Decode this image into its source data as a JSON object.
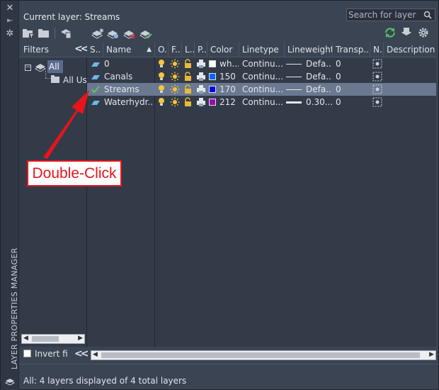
{
  "panel": {
    "vertical_title": "LAYER PROPERTIES MANAGER",
    "current_layer": "Current layer: Streams",
    "search_placeholder": "Search for layer"
  },
  "toolbar": {
    "icons": [
      "new-property-filter-icon",
      "new-group-filter-icon",
      "layer-states-manager-icon",
      "new-layer-icon",
      "new-layer-vp-frozen-icon",
      "delete-layer-icon",
      "set-current-icon",
      "refresh-icon",
      "settings-icon"
    ]
  },
  "filters": {
    "heading": "Filters",
    "tree_all": "All",
    "tree_all_used": "All Us",
    "invert_label": "Invert fi"
  },
  "grid": {
    "columns": [
      "S..",
      "Name",
      "O..",
      "F..",
      "L..",
      "P..",
      "Color",
      "Linetype",
      "Lineweight",
      "Transp...",
      "N..",
      "Description"
    ],
    "rows": [
      {
        "status": "layer",
        "name": "0",
        "color_name": "wh...",
        "color_hex": "#ffffff",
        "linetype": "Continu...",
        "lineweight": "Defa...",
        "transparency": "0",
        "selected": false
      },
      {
        "status": "layer",
        "name": "Canals",
        "color_name": "150",
        "color_hex": "#0066ff",
        "linetype": "Continu...",
        "lineweight": "Defa...",
        "transparency": "0",
        "selected": false
      },
      {
        "status": "current",
        "name": "Streams",
        "color_name": "170",
        "color_hex": "#0000ee",
        "linetype": "Continu...",
        "lineweight": "Defa...",
        "transparency": "0",
        "selected": true
      },
      {
        "status": "layer",
        "name": "Waterhydr...",
        "color_name": "212",
        "color_hex": "#9b00b4",
        "linetype": "Continu...",
        "lineweight": "0.30...",
        "transparency": "0",
        "selected": false
      }
    ]
  },
  "status_bar": {
    "text": "All: 4 layers displayed of 4 total layers"
  },
  "annotation": {
    "callout_text": "Double-Click",
    "color": "#e8141a"
  }
}
